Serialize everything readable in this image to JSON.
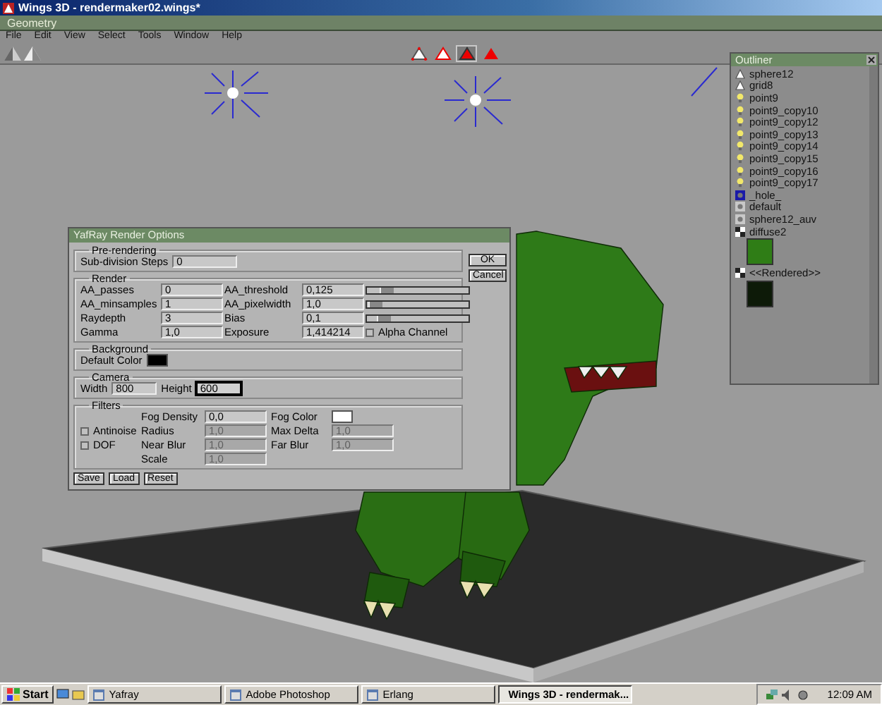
{
  "window": {
    "title": "Wings 3D - rendermaker02.wings*"
  },
  "geometry_bar": {
    "title": "Geometry"
  },
  "menu": [
    "File",
    "Edit",
    "View",
    "Select",
    "Tools",
    "Window",
    "Help"
  ],
  "toolbar": {
    "select_modes": [
      {
        "kind": "vertex",
        "selected": false
      },
      {
        "kind": "edge",
        "selected": false
      },
      {
        "kind": "face",
        "selected": true
      },
      {
        "kind": "body",
        "selected": false
      }
    ]
  },
  "dialog": {
    "title": "YafRay Render Options",
    "side_buttons": [
      "OK",
      "Cancel"
    ],
    "prerendering": {
      "legend": "Pre-rendering",
      "label": "Sub-division Steps",
      "value": "0"
    },
    "render": {
      "legend": "Render",
      "rows": [
        {
          "label": "AA_passes",
          "value": "0",
          "label_2": "AA_threshold",
          "value_2": "0,125",
          "kind": "slider",
          "level": 0.15
        },
        {
          "label": "AA_minsamples",
          "value": "1",
          "label_2": "AA_pixelwidth",
          "value_2": "1,0",
          "kind": "slider",
          "level": 0.02
        },
        {
          "label": "Raydepth",
          "value": "3",
          "label_2": "Bias",
          "value_2": "0,1",
          "kind": "slider",
          "level": 0.12
        },
        {
          "label": "Gamma",
          "value": "1,0",
          "label_2": "Exposure",
          "value_2": "1,414214",
          "kind": "checkbox",
          "checkbox_label": "Alpha Channel",
          "checked": false
        }
      ]
    },
    "background": {
      "legend": "Background",
      "label": "Default Color",
      "color": "#000000"
    },
    "camera": {
      "legend": "Camera",
      "fields": [
        {
          "label": "Width",
          "value": "800",
          "focused": false
        },
        {
          "label": "Height",
          "value": "600",
          "focused": true
        }
      ]
    },
    "filters": {
      "legend": "Filters",
      "rows": [
        {
          "field": {
            "label": "Fog Density",
            "value": "0,0",
            "disabled": false
          },
          "field_2": {
            "kind": "color",
            "label": "Fog Color",
            "color": "#ffffff"
          }
        },
        {
          "checkbox": {
            "label": "Antinoise",
            "checked": false
          },
          "field": {
            "label": "Radius",
            "value": "1,0",
            "disabled": true
          },
          "field_2": {
            "kind": "text",
            "label": "Max Delta",
            "value": "1,0",
            "disabled": true
          }
        },
        {
          "checkbox": {
            "label": "DOF",
            "checked": false
          },
          "field": {
            "label": "Near Blur",
            "value": "1,0",
            "disabled": true
          },
          "field_2": {
            "kind": "text",
            "label": "Far Blur",
            "value": "1,0",
            "disabled": true
          }
        },
        {
          "field": {
            "label": "Scale",
            "value": "1,0",
            "disabled": true
          }
        }
      ]
    },
    "buttons": [
      "Save",
      "Load",
      "Reset"
    ]
  },
  "outliner": {
    "title": "Outliner",
    "items": [
      {
        "label": "sphere12",
        "kind": "mesh"
      },
      {
        "label": "grid8",
        "kind": "mesh"
      },
      {
        "label": "point9",
        "kind": "light"
      },
      {
        "label": "point9_copy10",
        "kind": "light"
      },
      {
        "label": "point9_copy12",
        "kind": "light"
      },
      {
        "label": "point9_copy13",
        "kind": "light"
      },
      {
        "label": "point9_copy14",
        "kind": "light"
      },
      {
        "label": "point9_copy15",
        "kind": "light"
      },
      {
        "label": "point9_copy16",
        "kind": "light"
      },
      {
        "label": "point9_copy17",
        "kind": "light"
      },
      {
        "label": "_hole_",
        "kind": "material",
        "color": "#1a1aa8"
      },
      {
        "label": "default",
        "kind": "material",
        "color": "#c8c8c8"
      },
      {
        "label": "sphere12_auv",
        "kind": "material",
        "color": "#c8c8c8"
      },
      {
        "label": "diffuse2",
        "kind": "image",
        "color": "#2f7d16"
      },
      {
        "label": "<<Rendered>>",
        "kind": "image",
        "color": "#0d1a08"
      }
    ]
  },
  "taskbar": {
    "start": "Start",
    "tasks": [
      {
        "label": "Yafray",
        "selected": false
      },
      {
        "label": "Adobe Photoshop",
        "selected": false
      },
      {
        "label": "Erlang",
        "selected": false
      },
      {
        "label": "Wings 3D - rendermak...",
        "selected": true
      }
    ],
    "clock": "12:09 AM"
  }
}
